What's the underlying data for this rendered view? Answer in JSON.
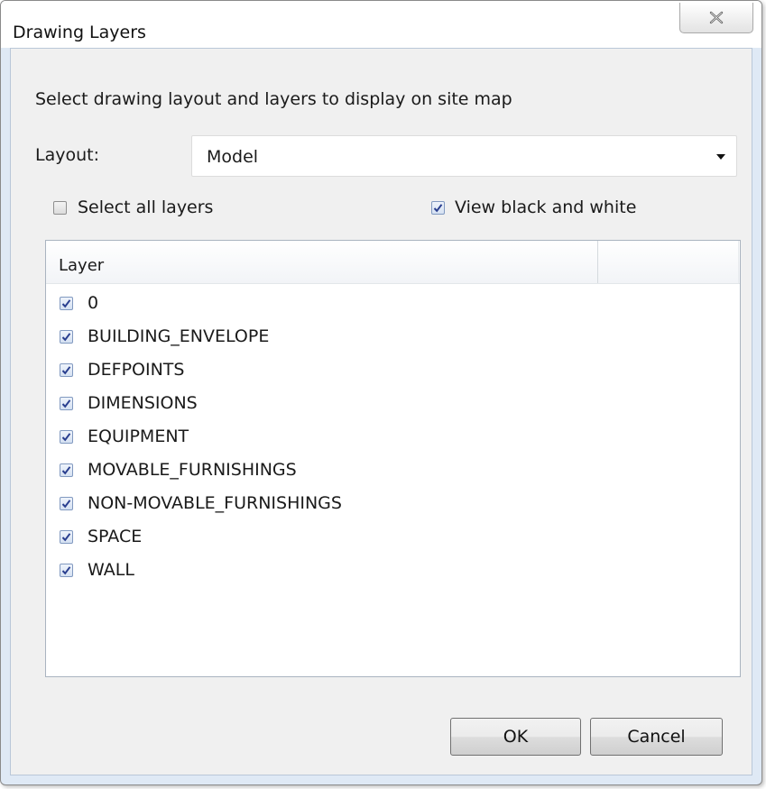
{
  "window": {
    "title": "Drawing Layers"
  },
  "instructions": "Select drawing layout and layers to display on site map",
  "layout": {
    "label": "Layout:",
    "selected": "Model"
  },
  "options": {
    "select_all": {
      "label": "Select all layers",
      "checked": false
    },
    "black_white": {
      "label": "View black and white",
      "checked": true
    }
  },
  "list": {
    "column_header": "Layer",
    "rows": [
      {
        "label": "0",
        "checked": true
      },
      {
        "label": "BUILDING_ENVELOPE",
        "checked": true
      },
      {
        "label": "DEFPOINTS",
        "checked": true
      },
      {
        "label": "DIMENSIONS",
        "checked": true
      },
      {
        "label": "EQUIPMENT",
        "checked": true
      },
      {
        "label": "MOVABLE_FURNISHINGS",
        "checked": true
      },
      {
        "label": "NON-MOVABLE_FURNISHINGS",
        "checked": true
      },
      {
        "label": "SPACE",
        "checked": true
      },
      {
        "label": "WALL",
        "checked": true
      }
    ]
  },
  "buttons": {
    "ok": "OK",
    "cancel": "Cancel"
  },
  "icons": {
    "close": "close-icon",
    "dropdown": "chevron-down-icon",
    "check": "checkmark-icon"
  }
}
